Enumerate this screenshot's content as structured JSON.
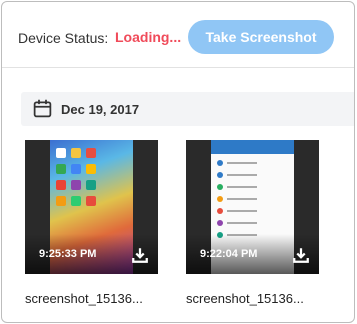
{
  "status": {
    "label": "Device Status:",
    "value": "Loading...",
    "value_color": "#f04b5a"
  },
  "toolbar": {
    "screenshot_button_label": "Take Screenshot",
    "button_color": "#90c6f5"
  },
  "gallery": {
    "date_icon": "calendar-icon",
    "date": "Dec 19, 2017",
    "items": [
      {
        "time": "9:25:33 PM",
        "filename": "screenshot_15136...",
        "download_icon": "download-icon"
      },
      {
        "time": "9:22:04 PM",
        "filename": "screenshot_15136...",
        "download_icon": "download-icon"
      }
    ]
  }
}
